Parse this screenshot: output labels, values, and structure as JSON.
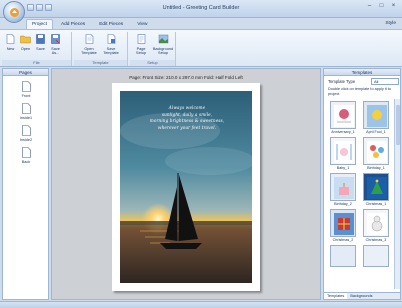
{
  "window": {
    "title": "Untitled - Greeting Card Builder",
    "style_label": "Style"
  },
  "tabs": [
    {
      "label": "Project",
      "active": true
    },
    {
      "label": "Add Pieces",
      "active": false
    },
    {
      "label": "Edit Pieces",
      "active": false
    },
    {
      "label": "View",
      "active": false
    }
  ],
  "ribbon": {
    "groups": [
      {
        "label": "File",
        "buttons": [
          "New",
          "Open",
          "Save",
          "Save As..."
        ]
      },
      {
        "label": "Template",
        "buttons": [
          "Open Template",
          "Save Template"
        ]
      },
      {
        "label": "Setup",
        "buttons": [
          "Page Setup",
          "Background Setup"
        ]
      }
    ]
  },
  "pages_panel": {
    "title": "Pages",
    "pages": [
      "Front",
      "Inside1",
      "Inside2",
      "Back"
    ]
  },
  "canvas": {
    "info": "Page: Front   Size: 210.0 x 297.0 mm   Fold: Half Fold Left",
    "greeting": [
      "Always welcome",
      "sunlight, daily a smile,",
      "morning brightness & sweetness,",
      "wherever your feet travel."
    ]
  },
  "templates_panel": {
    "title": "Templates",
    "type_label": "Template Type",
    "type_value": "All",
    "hint": "Double click on template to apply it to project",
    "items": [
      "Anniversary_1",
      "April Fool_1",
      "Baby_1",
      "Birthday_1",
      "Birthday_2",
      "Christmas_1",
      "Christmas_2",
      "Christmas_3"
    ],
    "tabs": [
      "Templates",
      "Backgrounds"
    ]
  }
}
